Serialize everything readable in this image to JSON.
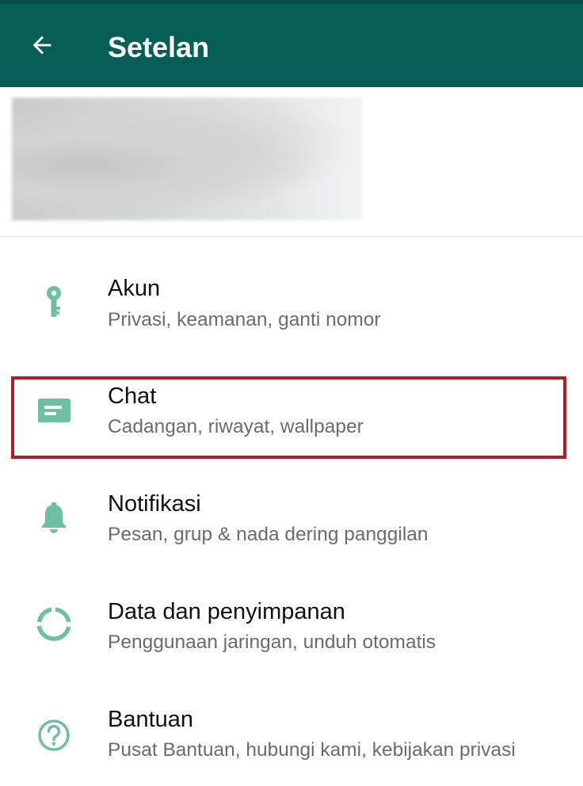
{
  "header": {
    "title": "Setelan",
    "back_icon": "arrow-left-icon"
  },
  "colors": {
    "header_bg": "#075e54",
    "icon_tint": "#6fbfa3",
    "highlight_border": "#b01c2b"
  },
  "settings": {
    "items": [
      {
        "label": "Akun",
        "subtitle": "Privasi, keamanan, ganti nomor",
        "icon": "key-icon"
      },
      {
        "label": "Chat",
        "subtitle": "Cadangan, riwayat, wallpaper",
        "icon": "chat-icon",
        "highlighted": true
      },
      {
        "label": "Notifikasi",
        "subtitle": "Pesan, grup & nada dering panggilan",
        "icon": "bell-icon"
      },
      {
        "label": "Data dan penyimpanan",
        "subtitle": "Penggunaan jaringan, unduh otomatis",
        "icon": "data-usage-icon"
      },
      {
        "label": "Bantuan",
        "subtitle": "Pusat Bantuan, hubungi kami, kebijakan privasi",
        "icon": "help-icon"
      }
    ]
  }
}
